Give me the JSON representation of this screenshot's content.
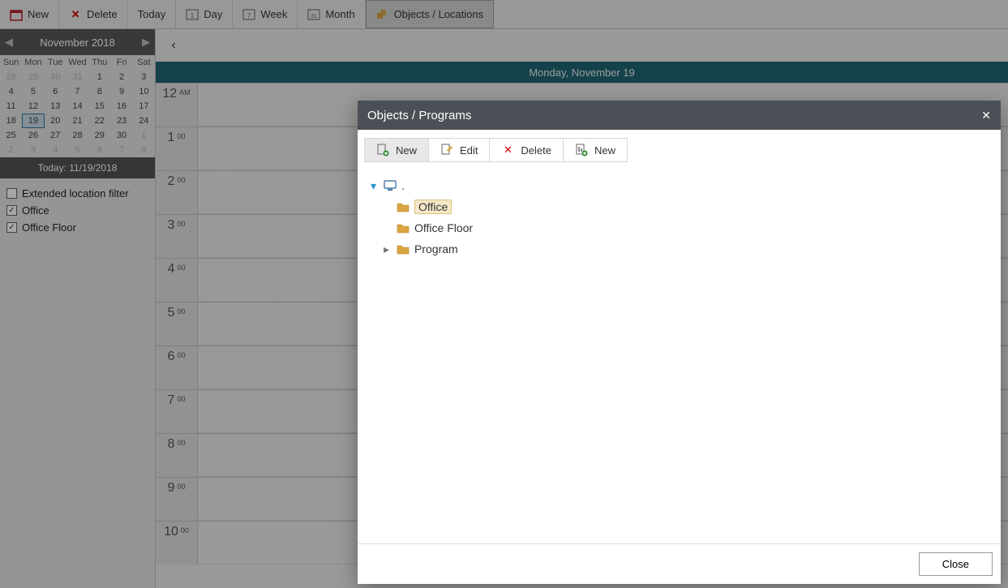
{
  "toolbar": {
    "new_label": "New",
    "delete_label": "Delete",
    "today_label": "Today",
    "day_label": "Day",
    "week_label": "Week",
    "month_label": "Month",
    "objects_label": "Objects / Locations"
  },
  "calendar": {
    "month_title": "November 2018",
    "day_headers": [
      "Sun",
      "Mon",
      "Tue",
      "Wed",
      "Thu",
      "Fri",
      "Sat"
    ],
    "weeks": [
      [
        {
          "d": "28",
          "dim": true
        },
        {
          "d": "29",
          "dim": true
        },
        {
          "d": "30",
          "dim": true
        },
        {
          "d": "31",
          "dim": true
        },
        {
          "d": "1"
        },
        {
          "d": "2"
        },
        {
          "d": "3"
        }
      ],
      [
        {
          "d": "4"
        },
        {
          "d": "5"
        },
        {
          "d": "6"
        },
        {
          "d": "7"
        },
        {
          "d": "8"
        },
        {
          "d": "9"
        },
        {
          "d": "10"
        }
      ],
      [
        {
          "d": "11"
        },
        {
          "d": "12"
        },
        {
          "d": "13"
        },
        {
          "d": "14"
        },
        {
          "d": "15"
        },
        {
          "d": "16"
        },
        {
          "d": "17"
        }
      ],
      [
        {
          "d": "18"
        },
        {
          "d": "19",
          "today": true
        },
        {
          "d": "20"
        },
        {
          "d": "21"
        },
        {
          "d": "22"
        },
        {
          "d": "23"
        },
        {
          "d": "24"
        }
      ],
      [
        {
          "d": "25"
        },
        {
          "d": "26"
        },
        {
          "d": "27"
        },
        {
          "d": "28"
        },
        {
          "d": "29"
        },
        {
          "d": "30"
        },
        {
          "d": "1",
          "dim": true
        }
      ],
      [
        {
          "d": "2",
          "dim": true
        },
        {
          "d": "3",
          "dim": true
        },
        {
          "d": "4",
          "dim": true
        },
        {
          "d": "5",
          "dim": true
        },
        {
          "d": "6",
          "dim": true
        },
        {
          "d": "7",
          "dim": true
        },
        {
          "d": "8",
          "dim": true
        }
      ]
    ],
    "today_strip": "Today: 11/19/2018"
  },
  "filters": {
    "extended_label": "Extended location filter",
    "extended_checked": false,
    "items": [
      {
        "label": "Office",
        "checked": true
      },
      {
        "label": "Office Floor",
        "checked": true
      }
    ]
  },
  "dayview": {
    "header": "Monday, November 19",
    "slots": [
      {
        "h": "12",
        "sup": "AM"
      },
      {
        "h": "1",
        "sup": "00"
      },
      {
        "h": "2",
        "sup": "00"
      },
      {
        "h": "3",
        "sup": "00"
      },
      {
        "h": "4",
        "sup": "00"
      },
      {
        "h": "5",
        "sup": "00"
      },
      {
        "h": "6",
        "sup": "00"
      },
      {
        "h": "7",
        "sup": "00"
      },
      {
        "h": "8",
        "sup": "00"
      },
      {
        "h": "9",
        "sup": "00"
      },
      {
        "h": "10",
        "sup": "00"
      }
    ]
  },
  "dialog": {
    "title": "Objects / Programs",
    "toolbar": {
      "new1": "New",
      "edit": "Edit",
      "delete": "Delete",
      "new2": "New"
    },
    "tree": {
      "root_label": ".",
      "items": [
        {
          "label": "Office",
          "selected": true
        },
        {
          "label": "Office Floor"
        },
        {
          "label": "Program",
          "expandable": true
        }
      ]
    },
    "close_label": "Close"
  }
}
